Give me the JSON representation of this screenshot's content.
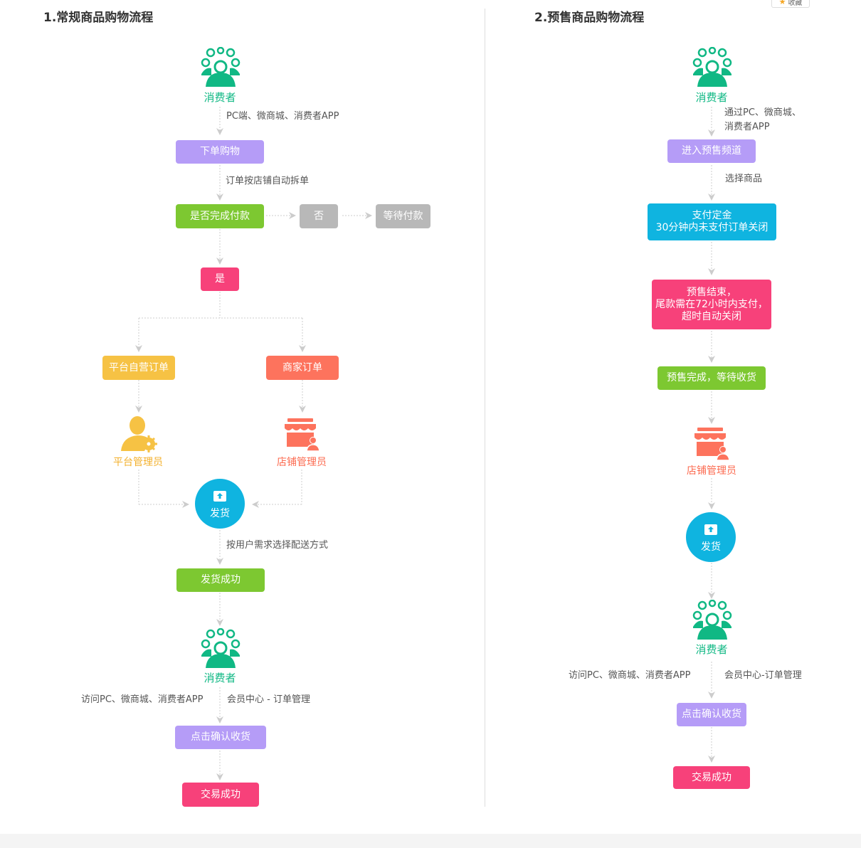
{
  "left": {
    "title": "1.常规商品购物流程",
    "consumer_top": "消费者",
    "note_channels": "PC端、微商城、消费者APP",
    "box_order": "下单购物",
    "note_split": "订单按店铺自动拆单",
    "box_paid": "是否完成付款",
    "box_no": "否",
    "box_wait": "等待付款",
    "box_yes": "是",
    "box_platform_order": "平台自营订单",
    "box_merchant_order": "商家订单",
    "platform_admin": "平台管理员",
    "store_admin": "店铺管理员",
    "ship": "发货",
    "note_delivery": "按用户需求选择配送方式",
    "box_ship_success": "发货成功",
    "consumer_bottom": "消费者",
    "note_visit": "访问PC、微商城、消费者APP",
    "note_member": "会员中心 - 订单管理",
    "box_confirm": "点击确认收货",
    "box_deal": "交易成功"
  },
  "right": {
    "title": "2.预售商品购物流程",
    "consumer_top": "消费者",
    "note_channels_1": "通过PC、微商城、",
    "note_channels_2": "消费者APP",
    "box_enter": "进入预售频道",
    "note_choose": "选择商品",
    "box_deposit_1": "支付定金",
    "box_deposit_2": "30分钟内未支付订单关闭",
    "box_end_1": "预售结束，",
    "box_end_2": "尾款需在72小时内支付，",
    "box_end_3": "超时自动关闭",
    "box_presale_done": "预售完成，等待收货",
    "store_admin": "店铺管理员",
    "ship": "发货",
    "consumer_bottom": "消费者",
    "note_visit": "访问PC、微商城、消费者APP",
    "note_member": "会员中心-订单管理",
    "box_confirm": "点击确认收货",
    "box_deal": "交易成功"
  },
  "favorite": "收藏",
  "colors": {
    "purple": "#b59cf7",
    "green": "#7dc831",
    "gray": "#b8b8b8",
    "pink": "#f7417a",
    "yellow": "#f6c244",
    "orange": "#fd735d",
    "blue": "#0fb4e0",
    "teal": "#10b884"
  }
}
